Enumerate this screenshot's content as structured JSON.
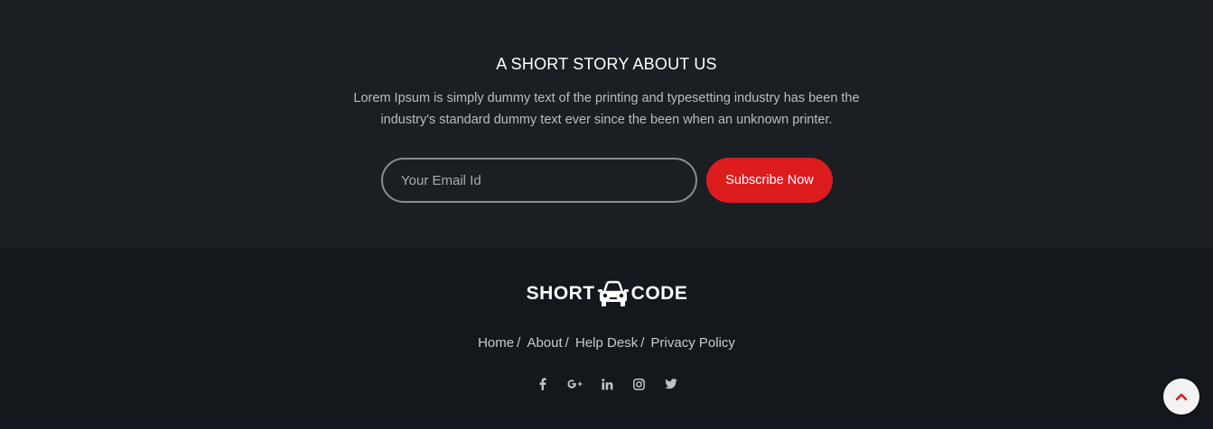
{
  "story": {
    "heading": "A SHORT STORY ABOUT US",
    "body": "Lorem Ipsum is simply dummy text of the printing and typesetting industry has been the industry's standard dummy text ever since the been when an unknown printer.",
    "email_placeholder": "Your Email Id",
    "subscribe_label": "Subscribe Now"
  },
  "footer": {
    "logo_left": "SHORT",
    "logo_right": "CODE",
    "logo_icon": "car-icon",
    "nav": [
      {
        "label": "Home"
      },
      {
        "label": "About"
      },
      {
        "label": "Help Desk"
      },
      {
        "label": "Privacy Policy"
      }
    ],
    "nav_separator": "/",
    "social": [
      "facebook-icon",
      "google-plus-icon",
      "linkedin-icon",
      "instagram-icon",
      "twitter-icon"
    ]
  },
  "colors": {
    "accent": "#dd1c1e",
    "story_bg": "#1b1f23",
    "footer_bg": "#14181c"
  }
}
